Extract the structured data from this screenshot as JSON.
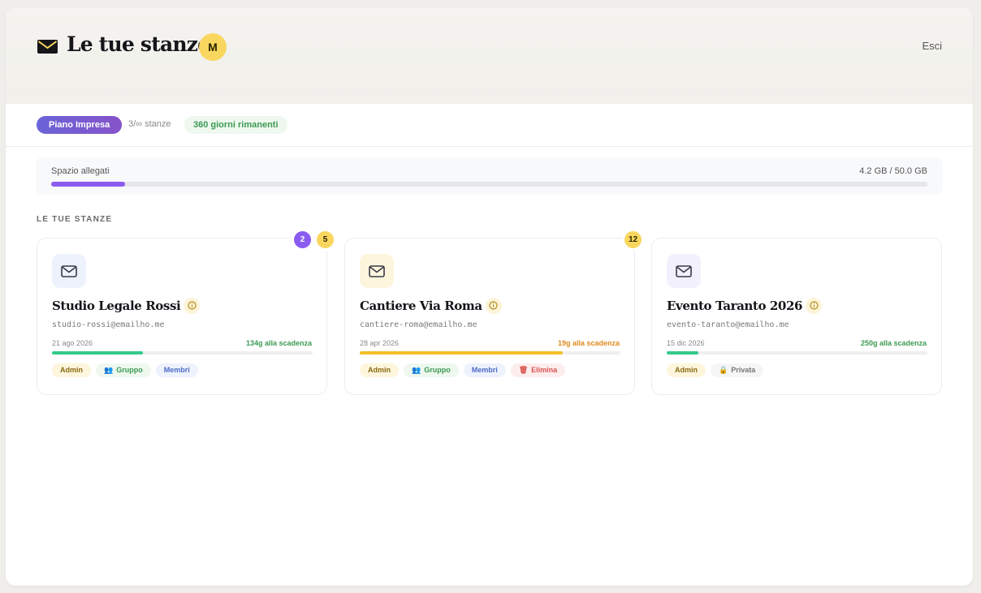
{
  "header": {
    "title": "Le tue stanze",
    "avatar_initial": "M",
    "logout_label": "Esci"
  },
  "plan": {
    "name": "Piano Impresa",
    "rooms": "3/∞ stanze",
    "days_left": "360 giorni rimanenti"
  },
  "storage": {
    "label": "Spazio allegati",
    "value": "4.2 GB / 50.0 GB",
    "used_fraction": 0.084
  },
  "section_title": "LE TUE STANZE",
  "colors": {
    "purple": "#8a5cf0",
    "yellow": "#f9d65e",
    "green": "#3c9a52",
    "orange": "#e08a1e"
  },
  "rooms": [
    {
      "name": "Studio Legale Rossi",
      "email": "studio-rossi@emailho.me",
      "date": "21 ago 2026",
      "expiry": "134g alla scadenza",
      "progress": 0.35,
      "badges": {
        "admin": "Admin",
        "gruppo": "Gruppo",
        "membri": "Membri"
      },
      "counters": [
        "2",
        "5"
      ]
    },
    {
      "name": "Cantiere Via Roma",
      "email": "cantiere-roma@emailho.me",
      "date": "28 apr 2026",
      "expiry": "19g alla scadenza",
      "progress": 0.78,
      "badges": {
        "admin": "Admin",
        "gruppo": "Gruppo",
        "membri": "Membri",
        "elimina": "Elimina"
      },
      "counters": [
        "12"
      ]
    },
    {
      "name": "Evento Taranto 2026",
      "email": "evento-taranto@emailho.me",
      "date": "15 dic 2026",
      "expiry": "250g alla scadenza",
      "progress": 0.12,
      "badges": {
        "admin": "Admin",
        "privata": "Privata"
      }
    }
  ]
}
